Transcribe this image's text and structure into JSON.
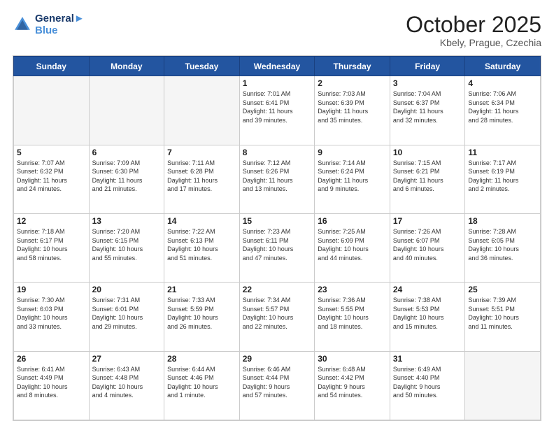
{
  "header": {
    "logo_line1": "General",
    "logo_line2": "Blue",
    "month": "October 2025",
    "location": "Kbely, Prague, Czechia"
  },
  "days_of_week": [
    "Sunday",
    "Monday",
    "Tuesday",
    "Wednesday",
    "Thursday",
    "Friday",
    "Saturday"
  ],
  "weeks": [
    [
      {
        "day": "",
        "text": ""
      },
      {
        "day": "",
        "text": ""
      },
      {
        "day": "",
        "text": ""
      },
      {
        "day": "1",
        "text": "Sunrise: 7:01 AM\nSunset: 6:41 PM\nDaylight: 11 hours\nand 39 minutes."
      },
      {
        "day": "2",
        "text": "Sunrise: 7:03 AM\nSunset: 6:39 PM\nDaylight: 11 hours\nand 35 minutes."
      },
      {
        "day": "3",
        "text": "Sunrise: 7:04 AM\nSunset: 6:37 PM\nDaylight: 11 hours\nand 32 minutes."
      },
      {
        "day": "4",
        "text": "Sunrise: 7:06 AM\nSunset: 6:34 PM\nDaylight: 11 hours\nand 28 minutes."
      }
    ],
    [
      {
        "day": "5",
        "text": "Sunrise: 7:07 AM\nSunset: 6:32 PM\nDaylight: 11 hours\nand 24 minutes."
      },
      {
        "day": "6",
        "text": "Sunrise: 7:09 AM\nSunset: 6:30 PM\nDaylight: 11 hours\nand 21 minutes."
      },
      {
        "day": "7",
        "text": "Sunrise: 7:11 AM\nSunset: 6:28 PM\nDaylight: 11 hours\nand 17 minutes."
      },
      {
        "day": "8",
        "text": "Sunrise: 7:12 AM\nSunset: 6:26 PM\nDaylight: 11 hours\nand 13 minutes."
      },
      {
        "day": "9",
        "text": "Sunrise: 7:14 AM\nSunset: 6:24 PM\nDaylight: 11 hours\nand 9 minutes."
      },
      {
        "day": "10",
        "text": "Sunrise: 7:15 AM\nSunset: 6:21 PM\nDaylight: 11 hours\nand 6 minutes."
      },
      {
        "day": "11",
        "text": "Sunrise: 7:17 AM\nSunset: 6:19 PM\nDaylight: 11 hours\nand 2 minutes."
      }
    ],
    [
      {
        "day": "12",
        "text": "Sunrise: 7:18 AM\nSunset: 6:17 PM\nDaylight: 10 hours\nand 58 minutes."
      },
      {
        "day": "13",
        "text": "Sunrise: 7:20 AM\nSunset: 6:15 PM\nDaylight: 10 hours\nand 55 minutes."
      },
      {
        "day": "14",
        "text": "Sunrise: 7:22 AM\nSunset: 6:13 PM\nDaylight: 10 hours\nand 51 minutes."
      },
      {
        "day": "15",
        "text": "Sunrise: 7:23 AM\nSunset: 6:11 PM\nDaylight: 10 hours\nand 47 minutes."
      },
      {
        "day": "16",
        "text": "Sunrise: 7:25 AM\nSunset: 6:09 PM\nDaylight: 10 hours\nand 44 minutes."
      },
      {
        "day": "17",
        "text": "Sunrise: 7:26 AM\nSunset: 6:07 PM\nDaylight: 10 hours\nand 40 minutes."
      },
      {
        "day": "18",
        "text": "Sunrise: 7:28 AM\nSunset: 6:05 PM\nDaylight: 10 hours\nand 36 minutes."
      }
    ],
    [
      {
        "day": "19",
        "text": "Sunrise: 7:30 AM\nSunset: 6:03 PM\nDaylight: 10 hours\nand 33 minutes."
      },
      {
        "day": "20",
        "text": "Sunrise: 7:31 AM\nSunset: 6:01 PM\nDaylight: 10 hours\nand 29 minutes."
      },
      {
        "day": "21",
        "text": "Sunrise: 7:33 AM\nSunset: 5:59 PM\nDaylight: 10 hours\nand 26 minutes."
      },
      {
        "day": "22",
        "text": "Sunrise: 7:34 AM\nSunset: 5:57 PM\nDaylight: 10 hours\nand 22 minutes."
      },
      {
        "day": "23",
        "text": "Sunrise: 7:36 AM\nSunset: 5:55 PM\nDaylight: 10 hours\nand 18 minutes."
      },
      {
        "day": "24",
        "text": "Sunrise: 7:38 AM\nSunset: 5:53 PM\nDaylight: 10 hours\nand 15 minutes."
      },
      {
        "day": "25",
        "text": "Sunrise: 7:39 AM\nSunset: 5:51 PM\nDaylight: 10 hours\nand 11 minutes."
      }
    ],
    [
      {
        "day": "26",
        "text": "Sunrise: 6:41 AM\nSunset: 4:49 PM\nDaylight: 10 hours\nand 8 minutes."
      },
      {
        "day": "27",
        "text": "Sunrise: 6:43 AM\nSunset: 4:48 PM\nDaylight: 10 hours\nand 4 minutes."
      },
      {
        "day": "28",
        "text": "Sunrise: 6:44 AM\nSunset: 4:46 PM\nDaylight: 10 hours\nand 1 minute."
      },
      {
        "day": "29",
        "text": "Sunrise: 6:46 AM\nSunset: 4:44 PM\nDaylight: 9 hours\nand 57 minutes."
      },
      {
        "day": "30",
        "text": "Sunrise: 6:48 AM\nSunset: 4:42 PM\nDaylight: 9 hours\nand 54 minutes."
      },
      {
        "day": "31",
        "text": "Sunrise: 6:49 AM\nSunset: 4:40 PM\nDaylight: 9 hours\nand 50 minutes."
      },
      {
        "day": "",
        "text": ""
      }
    ]
  ]
}
